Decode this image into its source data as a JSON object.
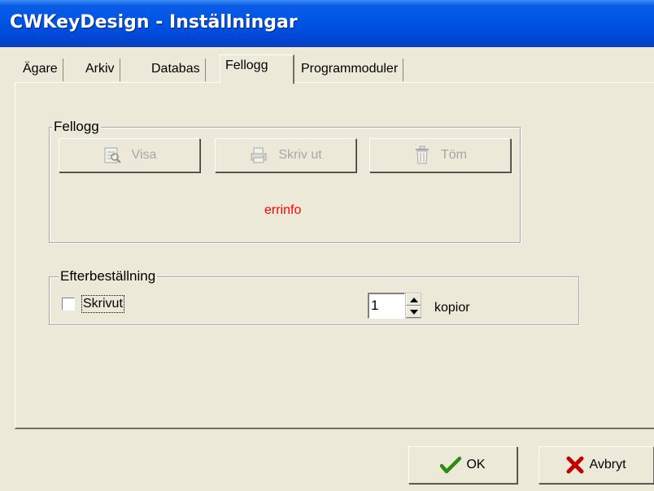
{
  "window": {
    "title": "CWKeyDesign - Inställningar"
  },
  "tabs": [
    {
      "label": "Ägare",
      "active": false
    },
    {
      "label": "Arkiv",
      "active": false
    },
    {
      "label": "Databas",
      "active": false
    },
    {
      "label": "Fellogg",
      "active": true
    },
    {
      "label": "Programmoduler",
      "active": false
    }
  ],
  "fellogg": {
    "group_label": "Fellogg",
    "buttons": [
      {
        "label": "Visa",
        "icon": "view-icon",
        "enabled": false
      },
      {
        "label": "Skriv ut",
        "icon": "printer-icon",
        "enabled": false
      },
      {
        "label": "Töm",
        "icon": "trash-icon",
        "enabled": false
      }
    ],
    "error_text": "errinfo",
    "error_color": "#ff0000"
  },
  "efterbestallning": {
    "group_label": "Efterbeställning",
    "checkbox_label": "Skrivut",
    "checked": false,
    "copies_value": "1",
    "copies_label": "kopior"
  },
  "footer": {
    "ok_label": "OK",
    "cancel_label": "Avbryt",
    "ok_icon": "checkmark-icon",
    "cancel_icon": "x-icon",
    "ok_icon_color": "#2e8b12",
    "cancel_icon_color": "#c00000"
  }
}
